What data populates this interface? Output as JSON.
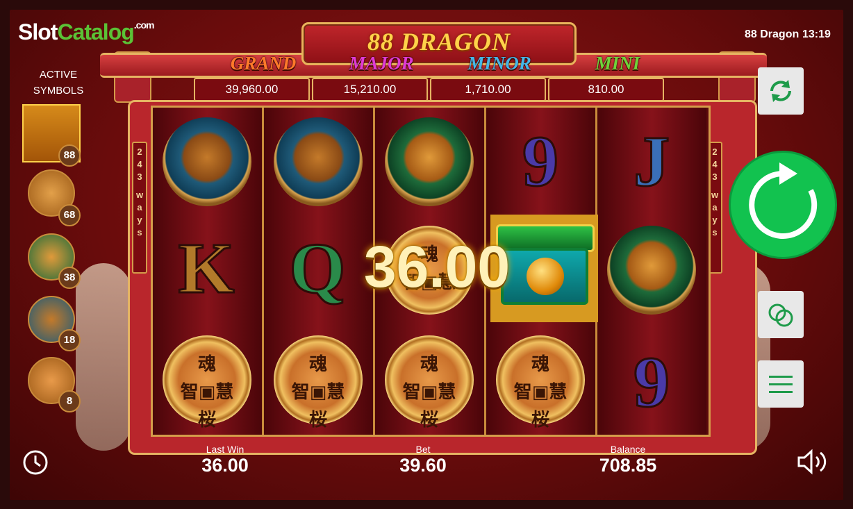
{
  "logo": {
    "part1": "Slot",
    "part2": "Catalog",
    "part3": ".com"
  },
  "header": {
    "game_name": "88 Dragon",
    "time": "13:19",
    "title": "88 DRAGON"
  },
  "jackpots": [
    {
      "label": "GRAND",
      "value": "39,960.00",
      "color": "#ff7a2a"
    },
    {
      "label": "MAJOR",
      "value": "15,210.00",
      "color": "#e03ad6"
    },
    {
      "label": "MINOR",
      "value": "1,710.00",
      "color": "#45b6e8"
    },
    {
      "label": "MINI",
      "value": "810.00",
      "color": "#6fd33a"
    }
  ],
  "ways": {
    "count": "243",
    "word": "ways"
  },
  "active_symbols": {
    "title_line1": "ACTIVE",
    "title_line2": "SYMBOLS",
    "items": [
      {
        "name": "dragon",
        "count": "88"
      },
      {
        "name": "phoenix",
        "count": "68"
      },
      {
        "name": "tiger",
        "count": "38"
      },
      {
        "name": "turtle",
        "count": "18"
      },
      {
        "name": "coin",
        "count": "8"
      }
    ]
  },
  "reels": [
    [
      "turtle",
      "K",
      "coin"
    ],
    [
      "turtle",
      "Q",
      "coin"
    ],
    [
      "tiger",
      "coin",
      "coin"
    ],
    [
      "9",
      "wild",
      "coin"
    ],
    [
      "J",
      "tiger",
      "9"
    ]
  ],
  "coin_text": {
    "top": "魂",
    "left": "智",
    "right": "慧",
    "bottom": "桜"
  },
  "win_amount": "36.00",
  "footer": {
    "last_win_label": "Last Win",
    "last_win": "36.00",
    "bet_label": "Bet",
    "bet": "39.60",
    "balance_label": "Balance",
    "balance": "708.85"
  },
  "colors": {
    "spin": "#12c24f",
    "frame_gold": "#e6b463",
    "bg_red": "#8e1717"
  }
}
